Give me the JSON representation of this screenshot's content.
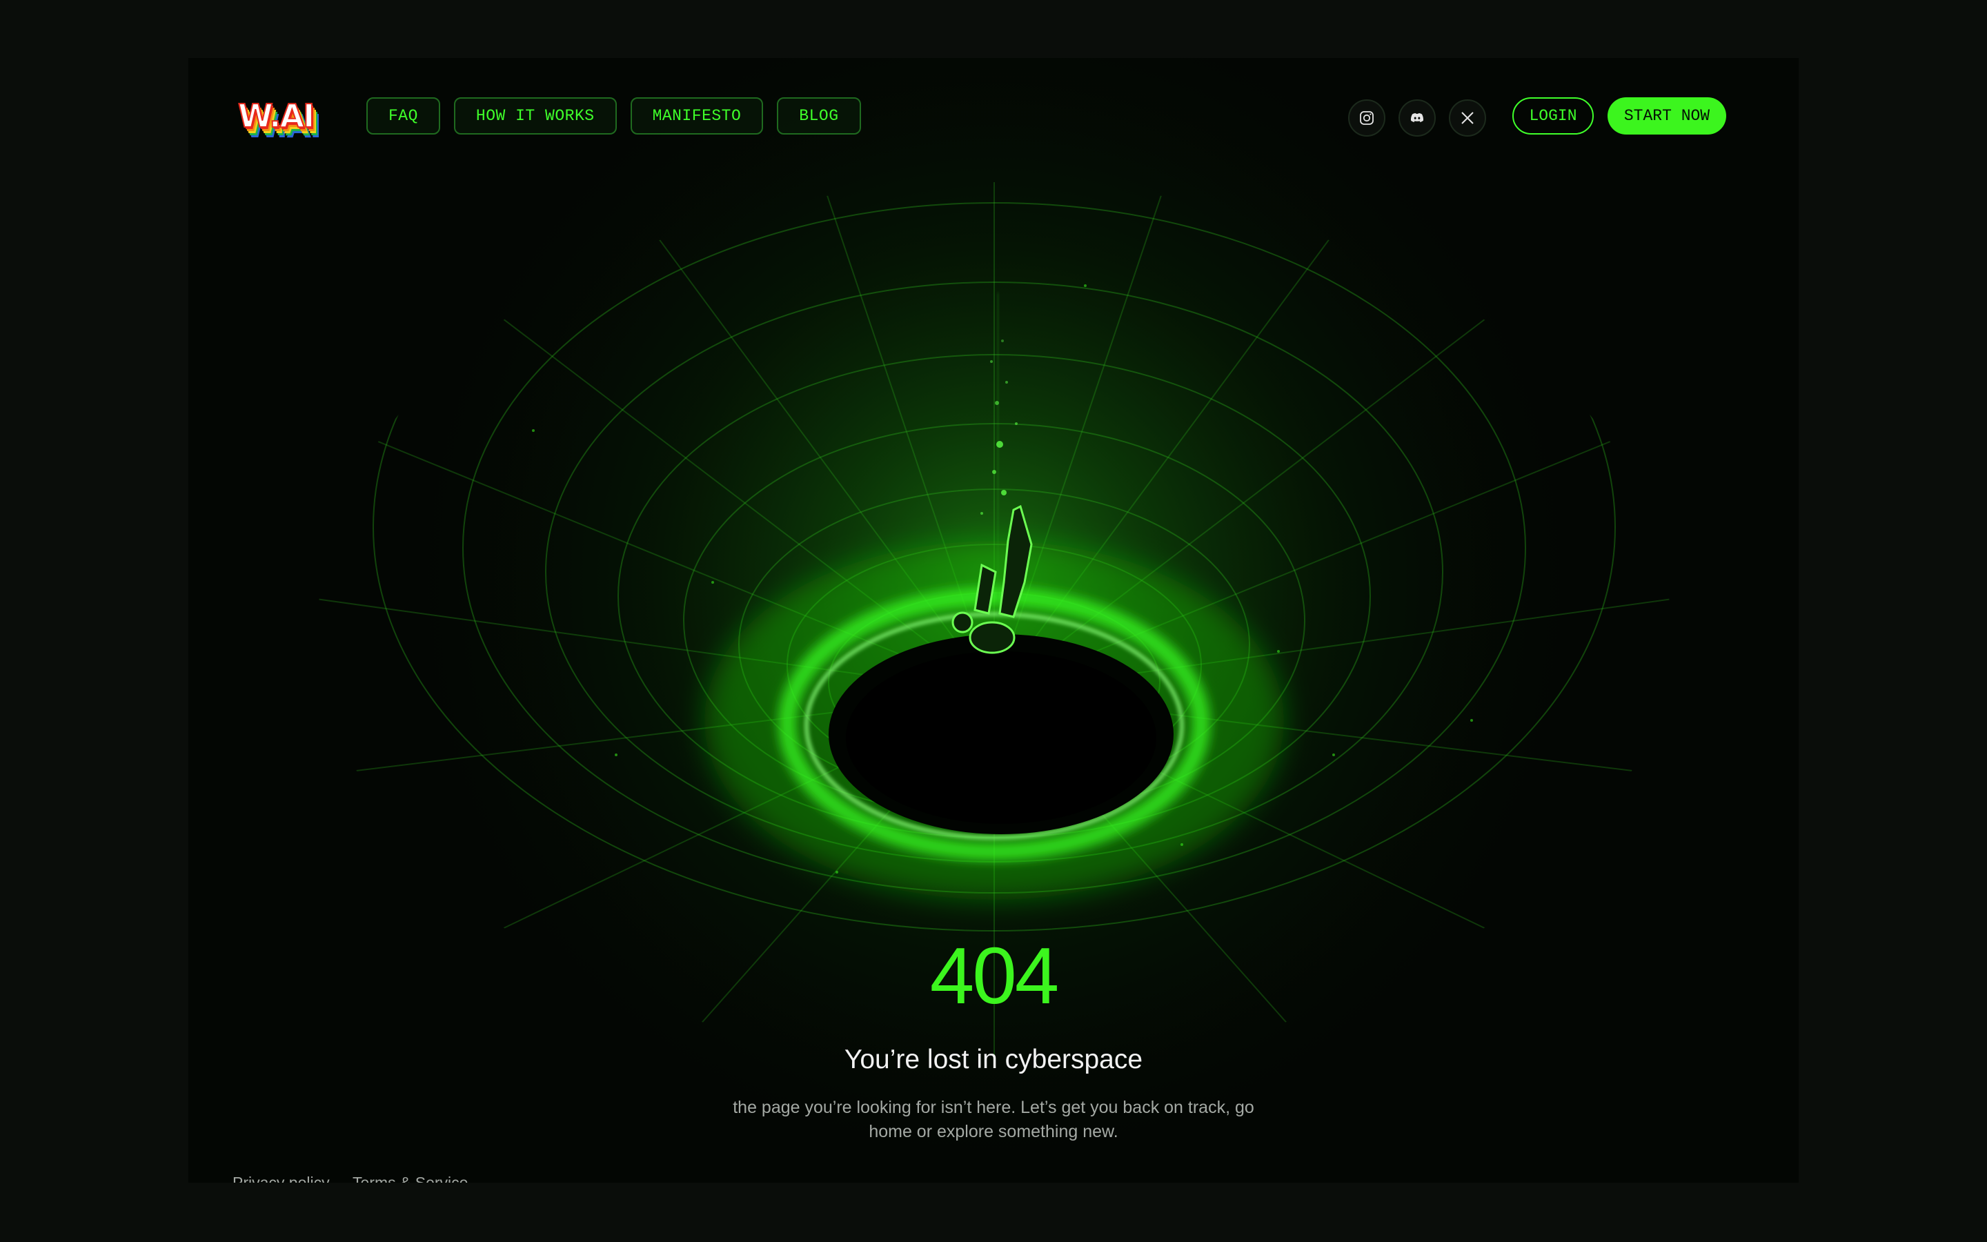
{
  "brand": {
    "logo_text": "W.AI",
    "colors": {
      "accent": "#3cf51e",
      "background": "#030603",
      "logo_rainbow": [
        "#e8291c",
        "#f39212",
        "#f2d21c",
        "#1fb34b",
        "#2a66d8"
      ]
    }
  },
  "nav": {
    "links": [
      {
        "label": "FAQ"
      },
      {
        "label": "HOW IT WORKS"
      },
      {
        "label": "MANIFESTO"
      },
      {
        "label": "BLOG"
      }
    ],
    "social": [
      {
        "icon": "instagram-icon"
      },
      {
        "icon": "discord-icon"
      },
      {
        "icon": "x-icon"
      }
    ],
    "login_label": "LOGIN",
    "start_label": "START NOW"
  },
  "hero": {
    "illustration": "falling-figure-into-green-wormhole",
    "code": "404",
    "headline": "You’re lost in cyberspace",
    "description": "the page you’re looking for isn’t here. Let’s get you back on track, go home or explore something new."
  },
  "footer": {
    "links": [
      {
        "label": "Privacy policy"
      },
      {
        "label": "Terms & Service"
      }
    ]
  }
}
